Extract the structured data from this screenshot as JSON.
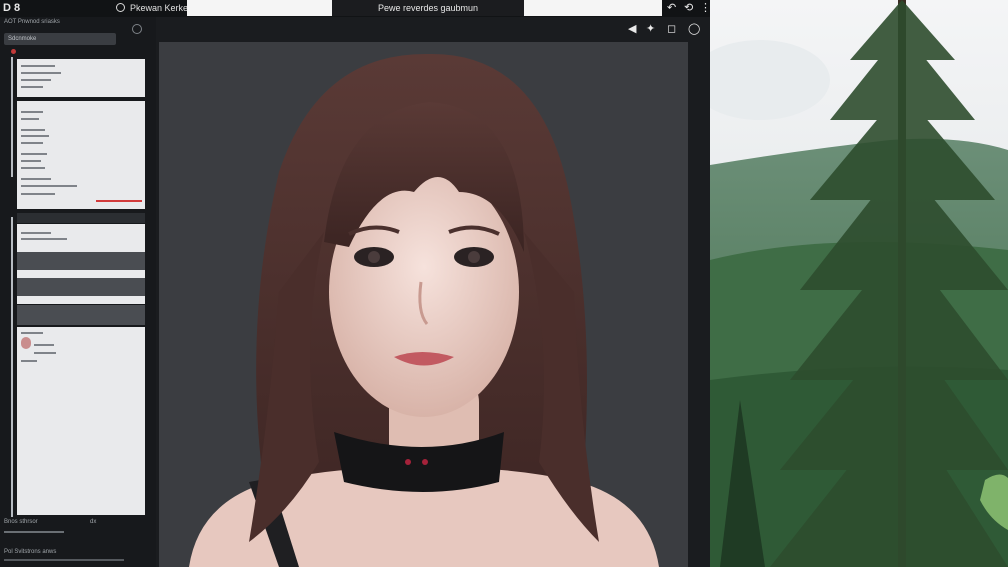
{
  "topbar": {
    "logo": "D 8",
    "title": "Pkewan Kerked",
    "center_title": "Pewe reverdes gaubmun",
    "controls": [
      "↶",
      "⟲",
      "⋮"
    ]
  },
  "left_panel": {
    "header": "AOT Pnwnod sriasks",
    "search_placeholder": "Sdcnmoke",
    "subheader": "",
    "card_lines": [
      "",
      "",
      "",
      ""
    ],
    "footer_left": "Bnos sthrsor",
    "footer_badge": "dx",
    "footer_bottom": "Pol  Svitstrons anws"
  },
  "toolbar": {
    "icons": [
      "◀",
      "✦",
      "◻",
      "◯"
    ]
  },
  "colors": {
    "accent": "#d23b3b",
    "panel_bg": "#17191c",
    "canvas_bg": "#3a3c40"
  }
}
